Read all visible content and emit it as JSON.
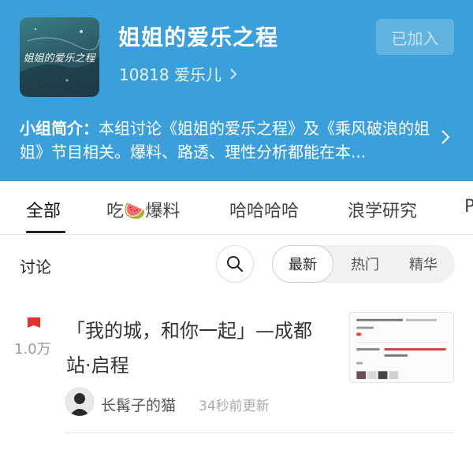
{
  "group": {
    "name": "姐姐的爱乐之程",
    "members": "10818 爱乐儿",
    "join_label": "已加入",
    "intro_label": "小组简介：",
    "intro_text": "本组讨论《姐姐的爱乐之程》及《乘风破浪的姐姐》节目相关。爆料、路透、理性分析都能在本...",
    "cover_text": "姐姐的爱乐之程"
  },
  "tabs": [
    {
      "label": "全部"
    },
    {
      "label": "吃🍉爆料"
    },
    {
      "label": "哈哈哈哈"
    },
    {
      "label": "浪学研究"
    },
    {
      "label": "P"
    }
  ],
  "toolbar": {
    "discuss_label": "讨论",
    "sort_options": [
      "最新",
      "热门",
      "精华"
    ]
  },
  "post": {
    "count": "1.0万",
    "title": "「我的城，和你一起」—成都站·启程",
    "author": "长髯子的猫",
    "time": "34秒前更新"
  },
  "colors": {
    "header_bg": "#3b9fd9",
    "flag_red": "#e0352b"
  },
  "icons": {
    "search": "search-icon",
    "flag": "flag-icon",
    "chevron": "chevron-right-icon"
  }
}
